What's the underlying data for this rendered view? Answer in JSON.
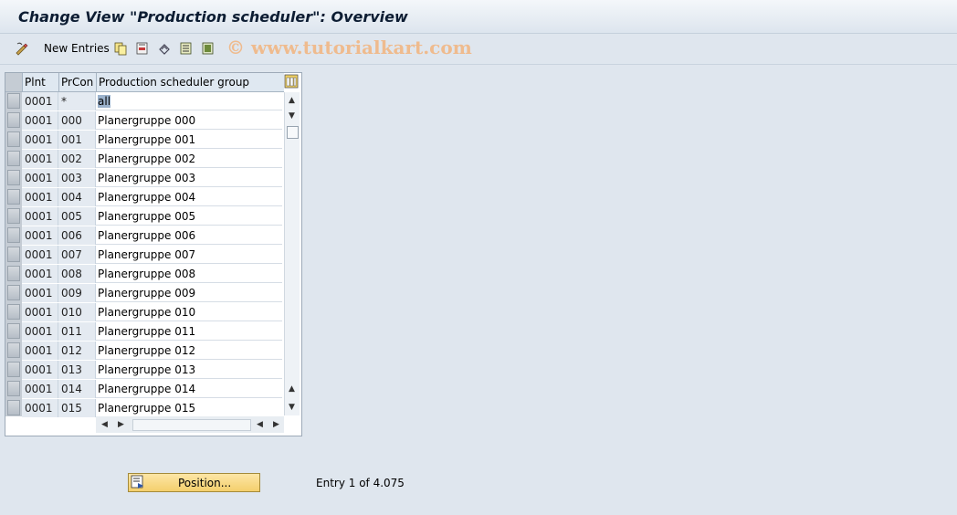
{
  "window": {
    "title": "Change View \"Production scheduler\": Overview"
  },
  "toolbar": {
    "new_entries_label": "New Entries",
    "icons": [
      "display-change-icon",
      "copy-icon",
      "delete-icon",
      "undo-icon",
      "select-all-icon",
      "deselect-all-icon"
    ]
  },
  "watermark": "© www.tutorialkart.com",
  "table": {
    "columns": [
      "Plnt",
      "PrCon",
      "Production scheduler group"
    ],
    "rows": [
      {
        "plnt": "0001",
        "prcon": "*",
        "group": "all"
      },
      {
        "plnt": "0001",
        "prcon": "000",
        "group": "Planergruppe 000"
      },
      {
        "plnt": "0001",
        "prcon": "001",
        "group": "Planergruppe 001"
      },
      {
        "plnt": "0001",
        "prcon": "002",
        "group": "Planergruppe 002"
      },
      {
        "plnt": "0001",
        "prcon": "003",
        "group": "Planergruppe 003"
      },
      {
        "plnt": "0001",
        "prcon": "004",
        "group": "Planergruppe 004"
      },
      {
        "plnt": "0001",
        "prcon": "005",
        "group": "Planergruppe 005"
      },
      {
        "plnt": "0001",
        "prcon": "006",
        "group": "Planergruppe 006"
      },
      {
        "plnt": "0001",
        "prcon": "007",
        "group": "Planergruppe 007"
      },
      {
        "plnt": "0001",
        "prcon": "008",
        "group": "Planergruppe 008"
      },
      {
        "plnt": "0001",
        "prcon": "009",
        "group": "Planergruppe 009"
      },
      {
        "plnt": "0001",
        "prcon": "010",
        "group": "Planergruppe 010"
      },
      {
        "plnt": "0001",
        "prcon": "011",
        "group": "Planergruppe 011"
      },
      {
        "plnt": "0001",
        "prcon": "012",
        "group": "Planergruppe 012"
      },
      {
        "plnt": "0001",
        "prcon": "013",
        "group": "Planergruppe 013"
      },
      {
        "plnt": "0001",
        "prcon": "014",
        "group": "Planergruppe 014"
      },
      {
        "plnt": "0001",
        "prcon": "015",
        "group": "Planergruppe 015"
      }
    ]
  },
  "footer": {
    "position_label": "Position...",
    "entry_info": "Entry 1 of 4.075"
  }
}
